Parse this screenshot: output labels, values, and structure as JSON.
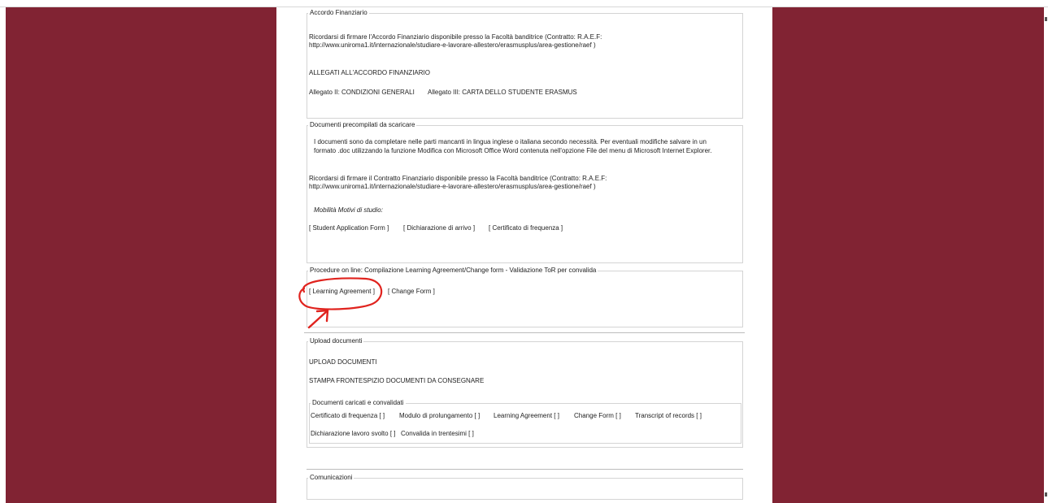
{
  "accordo": {
    "legend": "Accordo Finanziario",
    "line1": "Ricordarsi di firmare l'Accordo Finanziario disponibile presso la Facoltà banditrice (Contratto: R.A.E.F:",
    "line2": "http://www.uniroma1.it/internazionale/studiare-e-lavorare-allestero/erasmusplus/area-gestione/raef )",
    "allegati_title": "ALLEGATI ALL'ACCORDO FINANZIARIO",
    "allegato2": "Allegato II: CONDIZIONI GENERALI",
    "allegato3": "Allegato III: CARTA DELLO STUDENTE ERASMUS"
  },
  "documenti": {
    "legend": "Documenti precompilati da scaricare",
    "info1": "I documenti sono da completare nelle parti mancanti in lingua inglese o italiana secondo necessità. Per eventuali modifiche salvare in un",
    "info2": "formato .doc utilizzando la funzione Modifica con Microsoft Office Word contenuta nell'opzione File del menu di Microsoft Internet Explorer.",
    "contratto1": "Ricordarsi di firmare il Contratto Finanziario disponibile presso la Facoltà banditrice (Contratto: R.A.E.F:",
    "contratto2": "http://www.uniroma1.it/internazionale/studiare-e-lavorare-allestero/erasmusplus/area-gestione/raef )",
    "mobilita": "Mobilità  Motivi di studio:",
    "links": [
      "[ Student Application Form ]",
      "[ Dichiarazione di arrivo ]",
      "[ Certificato di frequenza ]"
    ]
  },
  "procedure": {
    "legend": "Procedure on line: Compilazione Learning Agreement/Change form - Validazione ToR per convalida",
    "learning": "[ Learning Agreement ]",
    "change": "[ Change Form ]",
    "annotation_color": "#e0231e"
  },
  "upload": {
    "legend": "Upload documenti",
    "upload_link": "UPLOAD DOCUMENTI",
    "stampa_link": "STAMPA FRONTESPIZIO DOCUMENTI DA CONSEGNARE",
    "caricati_legend": "Documenti caricati e convalidati",
    "row1": [
      "Certificato di frequenza [ ]",
      "Modulo di prolungamento [ ]",
      "Learning Agreement [ ]",
      "Change Form [ ]",
      "Transcript of records [ ]"
    ],
    "row2": [
      "Dichiarazione lavoro svolto [ ]",
      "Convalida in trentesimi [ ]"
    ]
  },
  "comunicazioni": {
    "legend": "Comunicazioni"
  },
  "colors": {
    "sidebar": "#812333",
    "border": "#d4d4d4"
  }
}
